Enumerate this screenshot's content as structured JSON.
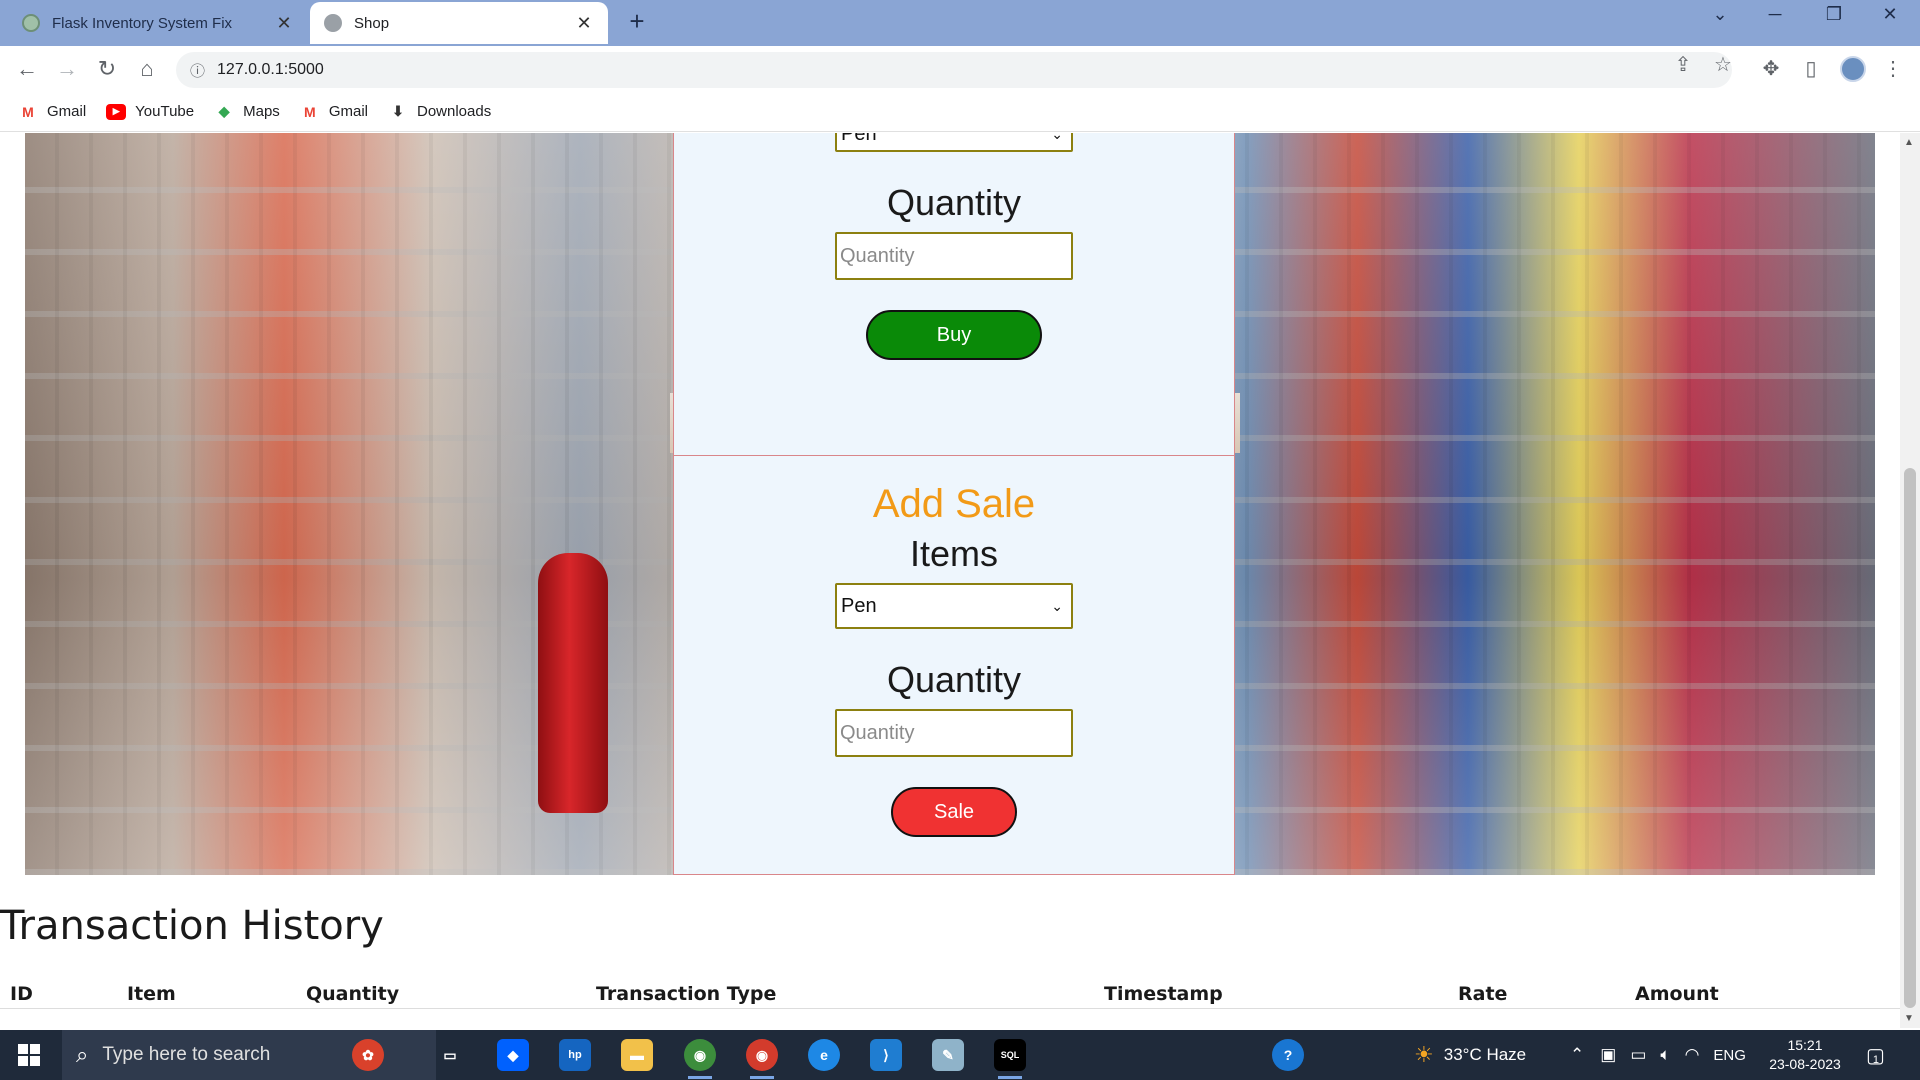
{
  "browser": {
    "tabs": [
      {
        "title": "Flask Inventory System Fix",
        "active": false,
        "favicon": "chatgpt-icon"
      },
      {
        "title": "Shop",
        "active": true,
        "favicon": "globe-icon"
      }
    ],
    "new_tab": "+",
    "address": "127.0.0.1:5000",
    "bookmarks": [
      {
        "label": "Gmail",
        "icon": "gmail-icon"
      },
      {
        "label": "YouTube",
        "icon": "youtube-icon"
      },
      {
        "label": "Maps",
        "icon": "maps-icon"
      },
      {
        "label": "Gmail",
        "icon": "gmail-icon"
      },
      {
        "label": "Downloads",
        "icon": "download-icon"
      }
    ]
  },
  "buy_panel": {
    "selected_item": "Pen",
    "quantity_label": "Quantity",
    "quantity_placeholder": "Quantity",
    "button": "Buy"
  },
  "sale_panel": {
    "heading": "Add Sale",
    "items_label": "Items",
    "selected_item": "Pen",
    "quantity_label": "Quantity",
    "quantity_placeholder": "Quantity",
    "button": "Sale"
  },
  "history": {
    "title": "Transaction History",
    "columns": [
      "ID",
      "Item",
      "Quantity",
      "Transaction Type",
      "Timestamp",
      "Rate",
      "Amount"
    ]
  },
  "taskbar": {
    "search_placeholder": "Type here to search",
    "weather": "33°C  Haze",
    "language": "ENG",
    "time": "15:21",
    "date": "23-08-2023",
    "notifications": "1"
  },
  "colors": {
    "heading_accent": "#f29a17",
    "buy_button": "#0a8a08",
    "sale_button": "#f03232",
    "panel_bg": "#eef6fd",
    "tabbar": "#8aa5d4"
  }
}
